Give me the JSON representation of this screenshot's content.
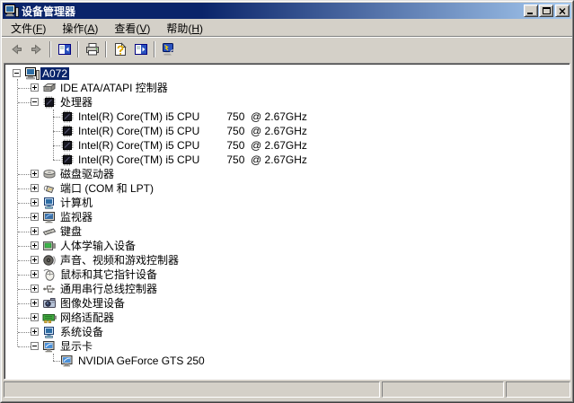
{
  "window": {
    "title": "设备管理器",
    "controls": [
      "minimize",
      "maximize",
      "close"
    ]
  },
  "menu": {
    "items": [
      {
        "pre": "文件(",
        "key": "F",
        "post": ")"
      },
      {
        "pre": "操作(",
        "key": "A",
        "post": ")"
      },
      {
        "pre": "查看(",
        "key": "V",
        "post": ")"
      },
      {
        "pre": "帮助(",
        "key": "H",
        "post": ")"
      }
    ]
  },
  "toolbar": {
    "buttons": [
      {
        "name": "back-button",
        "icon": "back-arrow-icon",
        "disabled": true
      },
      {
        "name": "forward-button",
        "icon": "forward-arrow-icon",
        "disabled": true
      },
      {
        "type": "separator"
      },
      {
        "name": "show-console-tree-button",
        "icon": "console-tree-icon",
        "disabled": false
      },
      {
        "type": "separator"
      },
      {
        "name": "print-button",
        "icon": "printer-icon",
        "disabled": false
      },
      {
        "type": "separator"
      },
      {
        "name": "help-button",
        "icon": "help-doc-icon",
        "disabled": false
      },
      {
        "name": "action-pane-button",
        "icon": "action-pane-icon",
        "disabled": false
      },
      {
        "type": "separator"
      },
      {
        "name": "scan-hardware-button",
        "icon": "scan-computer-icon",
        "disabled": false
      }
    ]
  },
  "tree": {
    "rows": [
      {
        "level": 0,
        "expand": "minus",
        "icon": "computer-icon",
        "label": "A072",
        "selected": true
      },
      {
        "level": 1,
        "expand": "plus",
        "icon": "ide-controller-icon",
        "label": "IDE ATA/ATAPI 控制器",
        "selected": false
      },
      {
        "level": 1,
        "expand": "minus",
        "icon": "processor-icon",
        "label": "处理器",
        "selected": false
      },
      {
        "level": 2,
        "expand": "none",
        "icon": "processor-icon",
        "label": "Intel(R) Core(TM) i5 CPU         750  @ 2.67GHz",
        "selected": false
      },
      {
        "level": 2,
        "expand": "none",
        "icon": "processor-icon",
        "label": "Intel(R) Core(TM) i5 CPU         750  @ 2.67GHz",
        "selected": false
      },
      {
        "level": 2,
        "expand": "none",
        "icon": "processor-icon",
        "label": "Intel(R) Core(TM) i5 CPU         750  @ 2.67GHz",
        "selected": false
      },
      {
        "level": 2,
        "expand": "none",
        "icon": "processor-icon",
        "label": "Intel(R) Core(TM) i5 CPU         750  @ 2.67GHz",
        "selected": false
      },
      {
        "level": 1,
        "expand": "plus",
        "icon": "disk-drive-icon",
        "label": "磁盘驱动器",
        "selected": false
      },
      {
        "level": 1,
        "expand": "plus",
        "icon": "port-icon",
        "label": "端口 (COM 和 LPT)",
        "selected": false
      },
      {
        "level": 1,
        "expand": "plus",
        "icon": "computer-device-icon",
        "label": "计算机",
        "selected": false
      },
      {
        "level": 1,
        "expand": "plus",
        "icon": "monitor-icon",
        "label": "监视器",
        "selected": false
      },
      {
        "level": 1,
        "expand": "plus",
        "icon": "keyboard-icon",
        "label": "键盘",
        "selected": false
      },
      {
        "level": 1,
        "expand": "plus",
        "icon": "hid-icon",
        "label": "人体学输入设备",
        "selected": false
      },
      {
        "level": 1,
        "expand": "plus",
        "icon": "sound-icon",
        "label": "声音、视频和游戏控制器",
        "selected": false
      },
      {
        "level": 1,
        "expand": "plus",
        "icon": "mouse-icon",
        "label": "鼠标和其它指针设备",
        "selected": false
      },
      {
        "level": 1,
        "expand": "plus",
        "icon": "usb-icon",
        "label": "通用串行总线控制器",
        "selected": false
      },
      {
        "level": 1,
        "expand": "plus",
        "icon": "imaging-icon",
        "label": "图像处理设备",
        "selected": false
      },
      {
        "level": 1,
        "expand": "plus",
        "icon": "network-adapter-icon",
        "label": "网络适配器",
        "selected": false
      },
      {
        "level": 1,
        "expand": "plus",
        "icon": "system-device-icon",
        "label": "系统设备",
        "selected": false
      },
      {
        "level": 1,
        "expand": "minus",
        "icon": "display-adapter-icon",
        "label": "显示卡",
        "selected": false
      },
      {
        "level": 2,
        "expand": "none",
        "icon": "display-adapter-icon",
        "label": "NVIDIA GeForce GTS 250",
        "selected": false
      }
    ]
  },
  "status_bar": {
    "panels": [
      "",
      "",
      ""
    ]
  },
  "colors": {
    "titlebar_start": "#0a246a",
    "titlebar_end": "#a6caf0",
    "window_bg": "#d4d0c8",
    "tree_bg": "#ffffff",
    "selection_bg": "#0a246a",
    "selection_text": "#ffffff"
  }
}
